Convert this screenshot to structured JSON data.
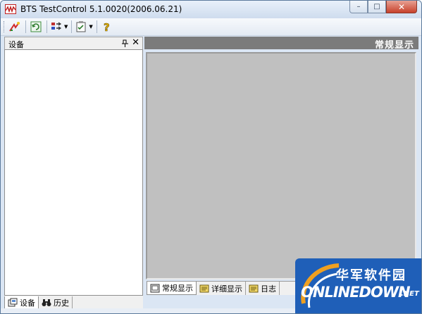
{
  "window": {
    "title": "BTS TestControl 5.1.0020(2006.06.21)",
    "minimize_glyph": "–",
    "maximize_glyph": "□",
    "close_glyph": "✕"
  },
  "toolbar": {
    "icons": [
      "connect-icon",
      "refresh-icon",
      "channel-config-icon",
      "task-icon",
      "help-icon"
    ]
  },
  "left_panel": {
    "title": "设备",
    "pin_glyph": "❘",
    "close_glyph": "✕",
    "tabs": [
      {
        "label": "设备",
        "icon": "device-icon"
      },
      {
        "label": "历史",
        "icon": "binoculars-icon"
      }
    ]
  },
  "right_panel": {
    "title": "常规显示",
    "tabs": [
      {
        "label": "常规显示",
        "icon": "display-icon"
      },
      {
        "label": "详细显示",
        "icon": "detail-icon"
      },
      {
        "label": "日志",
        "icon": "log-icon"
      }
    ]
  },
  "watermark": {
    "cn_text": "华军软件园",
    "en_text": "ONLINEDOWN",
    "suffix": ".NET"
  },
  "colors": {
    "right_header_bg": "#7b7b7b",
    "display_bg": "#c0c0c0",
    "watermark_bg": "#1f5fb8",
    "title_bar": "#dbe6f4"
  }
}
